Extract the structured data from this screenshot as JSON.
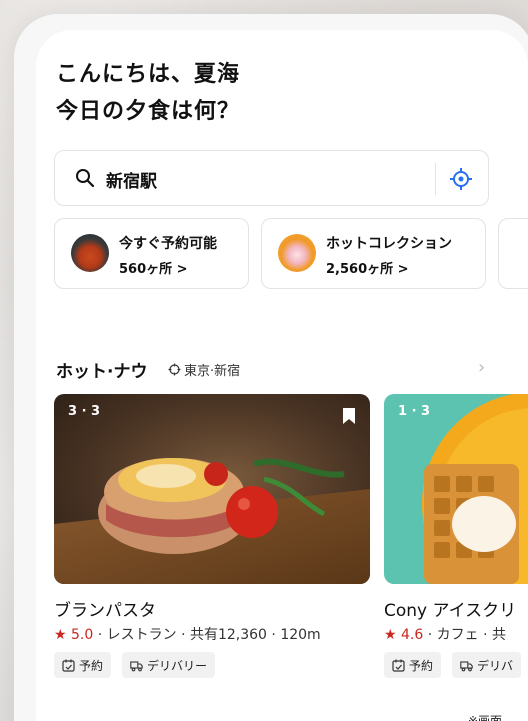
{
  "greeting": {
    "line1": "こんにちは、夏海",
    "line2": "今日の夕食は何？"
  },
  "search": {
    "value": "新宿駅",
    "search_icon": "search-icon",
    "location_icon": "locate-icon"
  },
  "quick_cards": [
    {
      "title": "今すぐ予約可能",
      "subtitle": "560ヶ所 >"
    },
    {
      "title": "ホットコレクション",
      "subtitle": "2,560ヶ所 >"
    }
  ],
  "section": {
    "title": "ホット·ナウ",
    "location": "東京·新宿"
  },
  "restaurants": [
    {
      "pager": "3 · 3",
      "name": "ブランパスタ",
      "star": "★",
      "rating": "5.0",
      "meta": " · レストラン · 共有12,360 · 120m",
      "tags": [
        "予約",
        "デリバリー"
      ]
    },
    {
      "pager": "1 · 3",
      "name": "Cony アイスクリ",
      "star": "★",
      "rating": "4.6",
      "meta": " · カフェ · 共",
      "tags": [
        "予約",
        "デリバ"
      ]
    }
  ],
  "footnote": "※画面",
  "colors": {
    "accent_blue": "#2a6ff0",
    "rating_red": "#c8281e"
  }
}
